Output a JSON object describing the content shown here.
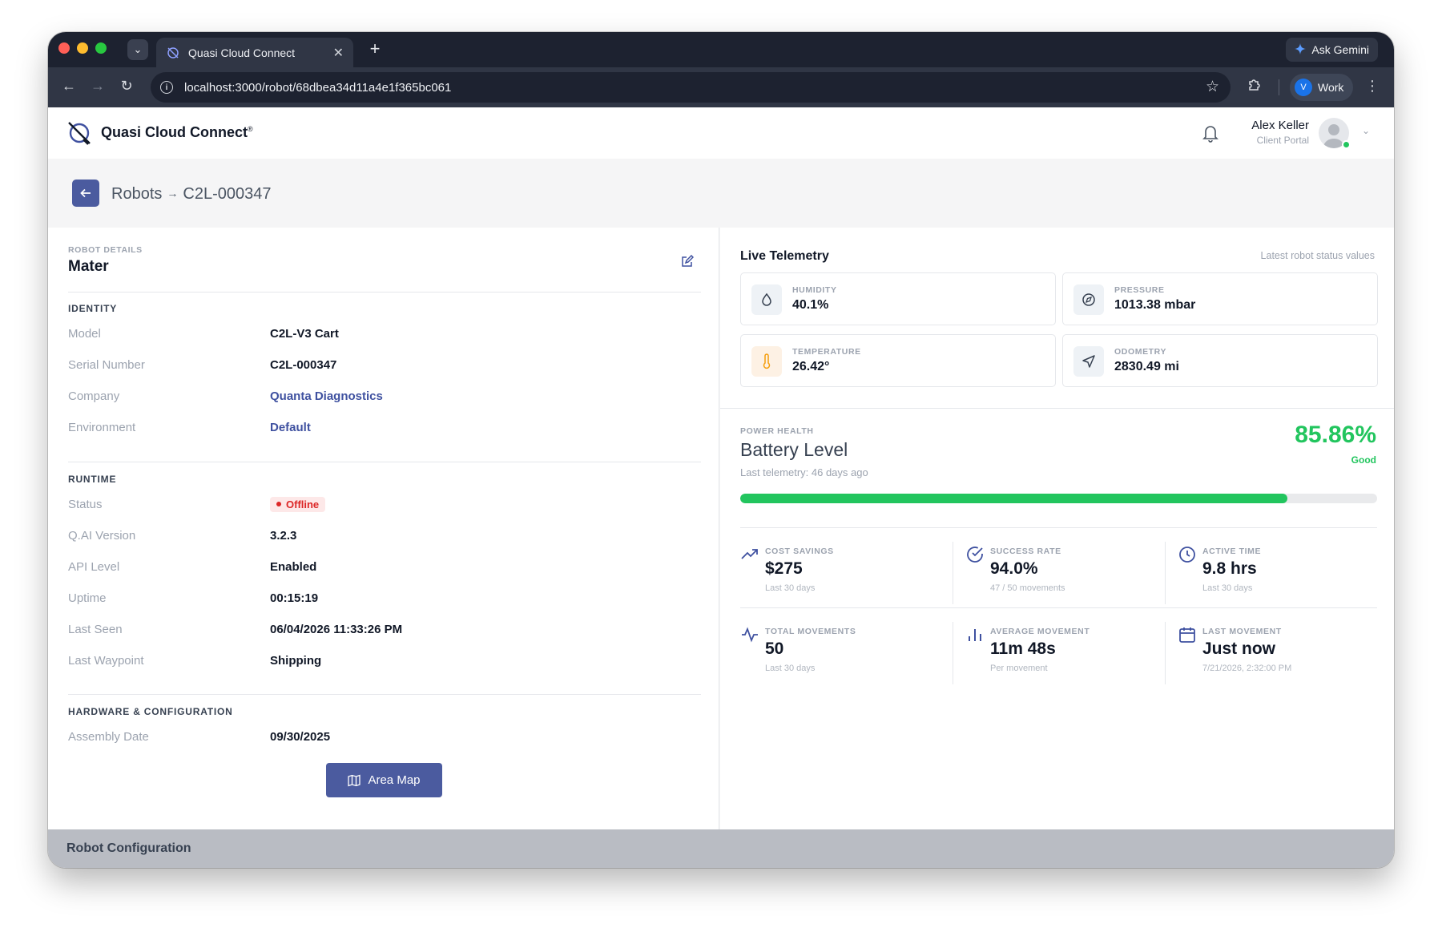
{
  "browser": {
    "tab_title": "Quasi Cloud Connect",
    "new_tab": "+",
    "gemini_label": "Ask Gemini",
    "url": "localhost:3000/robot/68dbea34d11a4e1f365bc061",
    "profile_initial": "V",
    "profile_label": "Work"
  },
  "header": {
    "brand": "Quasi Cloud Connect",
    "brand_mark": "®",
    "user_name": "Alex Keller",
    "user_role": "Client Portal"
  },
  "breadcrumb": {
    "parent": "Robots",
    "separator": "→",
    "current": "C2L-000347"
  },
  "robot": {
    "caption": "ROBOT DETAILS",
    "name": "Mater",
    "identity_title": "IDENTITY",
    "identity": [
      {
        "label": "Model",
        "value": "C2L-V3 Cart"
      },
      {
        "label": "Serial Number",
        "value": "C2L-000347"
      },
      {
        "label": "Company",
        "value": "Quanta Diagnostics"
      },
      {
        "label": "Environment",
        "value": "Default"
      }
    ],
    "runtime_title": "RUNTIME",
    "status_label": "Status",
    "status_value": "Offline",
    "runtime": [
      {
        "label": "Q.AI Version",
        "value": "3.2.3"
      },
      {
        "label": "API Level",
        "value": "Enabled"
      },
      {
        "label": "Uptime",
        "value": "00:15:19"
      },
      {
        "label": "Last Seen",
        "value": "06/04/2026 11:33:26 PM"
      },
      {
        "label": "Last Waypoint",
        "value": "Shipping"
      }
    ],
    "hardware_title": "HARDWARE & CONFIGURATION",
    "hardware": [
      {
        "label": "Assembly Date",
        "value": "09/30/2025"
      }
    ],
    "area_map_label": "Area Map"
  },
  "telemetry": {
    "title": "Live Telemetry",
    "hint": "Latest robot status values",
    "items": [
      {
        "label": "HUMIDITY",
        "value": "40.1%",
        "icon": "droplet-icon"
      },
      {
        "label": "PRESSURE",
        "value": "1013.38 mbar",
        "icon": "gauge-icon"
      },
      {
        "label": "TEMPERATURE",
        "value": "26.42°",
        "icon": "thermometer-icon"
      },
      {
        "label": "ODOMETRY",
        "value": "2830.49 mi",
        "icon": "navigation-icon"
      }
    ]
  },
  "battery": {
    "caption": "POWER HEALTH",
    "title": "Battery Level",
    "last": "Last telemetry: 46 days ago",
    "percent_text": "85.86%",
    "level": 85.86,
    "state": "Good"
  },
  "stats": [
    {
      "label": "COST SAVINGS",
      "value": "$275",
      "sub": "Last 30 days",
      "icon": "trending-up-icon"
    },
    {
      "label": "SUCCESS RATE",
      "value": "94.0%",
      "sub": "47 / 50 movements",
      "icon": "check-circle-icon"
    },
    {
      "label": "ACTIVE TIME",
      "value": "9.8 hrs",
      "sub": "Last 30 days",
      "icon": "clock-icon"
    },
    {
      "label": "TOTAL MOVEMENTS",
      "value": "50",
      "sub": "Last 30 days",
      "icon": "activity-icon"
    },
    {
      "label": "AVERAGE MOVEMENT",
      "value": "11m 48s",
      "sub": "Per movement",
      "icon": "bar-chart-icon"
    },
    {
      "label": "LAST MOVEMENT",
      "value": "Just now",
      "sub": "7/21/2026, 2:32:00 PM",
      "icon": "calendar-icon"
    }
  ],
  "footer": {
    "config_label": "Robot Configuration"
  },
  "colors": {
    "accent": "#4b5b9f",
    "good": "#22c55e",
    "offline": "#dc2626"
  }
}
